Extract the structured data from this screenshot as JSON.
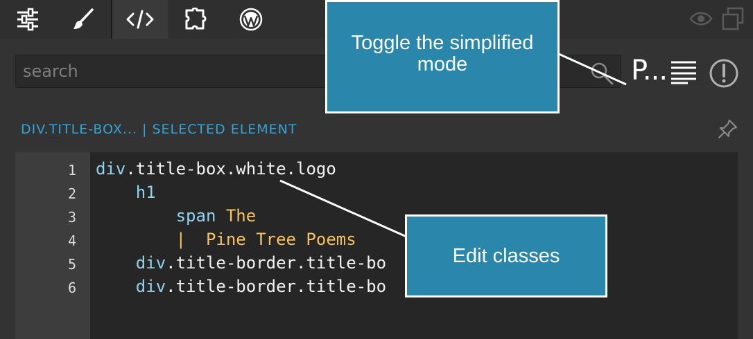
{
  "tabs": [
    {
      "id": "settings",
      "icon": "sliders-icon",
      "active": false
    },
    {
      "id": "style",
      "icon": "paintbrush-icon",
      "active": false
    },
    {
      "id": "code",
      "icon": "code-icon",
      "active": true
    },
    {
      "id": "components",
      "icon": "puzzle-icon",
      "active": false
    },
    {
      "id": "wordpress",
      "icon": "wordpress-icon",
      "active": false
    }
  ],
  "toolbar": {
    "right_icons": [
      "eye-icon",
      "duplicate-icon"
    ],
    "simplified_mode_label": "P...",
    "format_icon": "align-lines-icon",
    "alert_icon": "exclamation-circle-icon"
  },
  "search": {
    "placeholder": "search"
  },
  "breadcrumb": {
    "path": "DIV.TITLE-BOX...",
    "separator": "|",
    "label": "SELECTED ELEMENT"
  },
  "code": {
    "line_numbers": [
      "1",
      "2",
      "3",
      "4",
      "5",
      "6"
    ],
    "lines": [
      {
        "indent": "",
        "tag": "div",
        "classes": ".title-box.white.logo",
        "text": ""
      },
      {
        "indent": "    ",
        "tag": "h1",
        "classes": "",
        "text": ""
      },
      {
        "indent": "        ",
        "tag": "span",
        "classes": "",
        "text": " The"
      },
      {
        "indent": "        ",
        "tag": "",
        "classes": "",
        "text": "|  Pine Tree Poems"
      },
      {
        "indent": "    ",
        "tag": "div",
        "classes": ".title-border.title-bo",
        "text": ""
      },
      {
        "indent": "    ",
        "tag": "div",
        "classes": ".title-border.title-bo",
        "text": ""
      }
    ]
  },
  "callouts": {
    "simplified": "Toggle the simplified mode",
    "classes": "Edit classes"
  },
  "colors": {
    "background": "#333333",
    "editor_bg": "#262626",
    "gutter_bg": "#3d3d3d",
    "accent": "#34a4d7",
    "callout_bg": "#2b86ab",
    "tag": "#8fd4ef",
    "text_string": "#f5c25c"
  }
}
